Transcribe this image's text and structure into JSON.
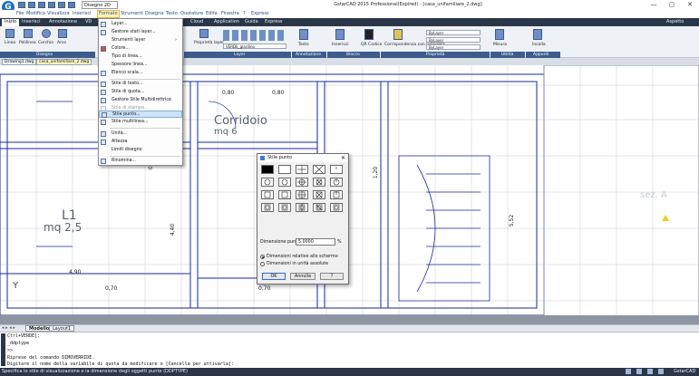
{
  "title": "GstarCAD 2015 Professional(Expired) - [casa_unifamiliare_2.dwg]",
  "workspace": "Disegno 2D",
  "window_controls": [
    "—",
    "▢",
    "✕"
  ],
  "menubar": [
    "File",
    "Modifica",
    "Visualizza",
    "Inserisci",
    "Formato",
    "Strumenti",
    "Disegna",
    "Testo",
    "Quotature",
    "Edita",
    "Finestra",
    "?",
    "Express"
  ],
  "ribbon_tabs": [
    "Inizio",
    "Inserisci",
    "Annotazione",
    "VD",
    "Cloud",
    "Application",
    "Guida",
    "Express"
  ],
  "ribbon_right": "Aspetto",
  "ribbon": {
    "draw_tools": [
      "Linea",
      "Polilinea",
      "Cerchio",
      "Arco"
    ],
    "panel_disegno": "Disegno",
    "props_label": "Proprietà layer",
    "layer_current": "VERDE_giardino",
    "panel_layer": "Layer",
    "text_label": "Testo",
    "panel_annot": "Annotazione",
    "insert_label": "Inserisci",
    "qr_label": "QR Codice",
    "panel_blocco": "Blocco",
    "match_label": "Corrispondenza con proprietà",
    "bylayer": [
      "ByLayer",
      "ByLayer",
      "ByLayer"
    ],
    "panel_prop": "Proprietà",
    "misura_label": "Misura",
    "panel_util": "Utilità",
    "incolla_label": "Incolla",
    "panel_appunti": "Appunti"
  },
  "doc_tabs": [
    "Drawing1.dwg",
    "casa_unifamiliare_2.dwg"
  ],
  "format_menu": [
    {
      "label": "Layer...",
      "state": "normal"
    },
    {
      "label": "Gestore stati layer...",
      "state": "normal"
    },
    {
      "label": "Strumenti layer",
      "state": "normal",
      "submenu": "›"
    },
    {
      "label": "Colore...",
      "state": "normal"
    },
    {
      "label": "Tipo di linea...",
      "state": "normal"
    },
    {
      "label": "Spessore linea...",
      "state": "normal"
    },
    {
      "label": "Elenco scala...",
      "state": "normal"
    },
    {
      "label": "Stile di testo...",
      "state": "normal"
    },
    {
      "label": "Stile di quota...",
      "state": "normal"
    },
    {
      "label": "Gestore Stile Multidirettrice",
      "state": "normal"
    },
    {
      "label": "Stile di stampa...",
      "state": "disabled"
    },
    {
      "label": "Stile punto...",
      "state": "highlight"
    },
    {
      "label": "Stile multilinea...",
      "state": "normal"
    },
    {
      "label": "Unità...",
      "state": "normal"
    },
    {
      "label": "Altezza",
      "state": "normal"
    },
    {
      "label": "Limiti disegno",
      "state": "normal"
    },
    {
      "label": "Rinomina...",
      "state": "normal"
    }
  ],
  "drawing_labels": {
    "corridoio": "Corridoio",
    "corridoio_mq": "mq  6",
    "l1": "L1",
    "l1_mq": "mq 2,5",
    "d080a": "0,80",
    "d080b": "0,80",
    "d085": "0,85",
    "d440": "4,40",
    "d490": "4,90",
    "d070a": "0,70",
    "d070b": "0,70",
    "d120": "1,20",
    "d552": "5,52",
    "sez": "sez. A",
    "y": "Y"
  },
  "dialog": {
    "title": "Stile punto",
    "size_label": "Dimensione punto:",
    "size_value": "5.0000",
    "unit": "%",
    "opt_relative": "Dimensioni relative allo schermo",
    "opt_absolute": "Dimensioni in unità assolute",
    "ok": "OK",
    "cancel": "Annulla",
    "help": "?"
  },
  "layout_tabs": [
    "Modello",
    "Layout1"
  ],
  "command_lines": [
    "Ctrl+VERDE];",
    "_ddptype",
    ">>",
    "Riprese del comando DIMOVERRIDE.",
    "Digitare il nome della variabile di quota da modificare o [Cancella per attivarla]:"
  ],
  "status_text": "Specifica lo stile di visualizzazione e la dimensione degli oggetti punto (DDPTYPE)",
  "status_app": "GstarCAD",
  "colors": {
    "accent": "#2b3648",
    "highlight": "#cde3f8",
    "draw_line": "#1a2a9a"
  }
}
